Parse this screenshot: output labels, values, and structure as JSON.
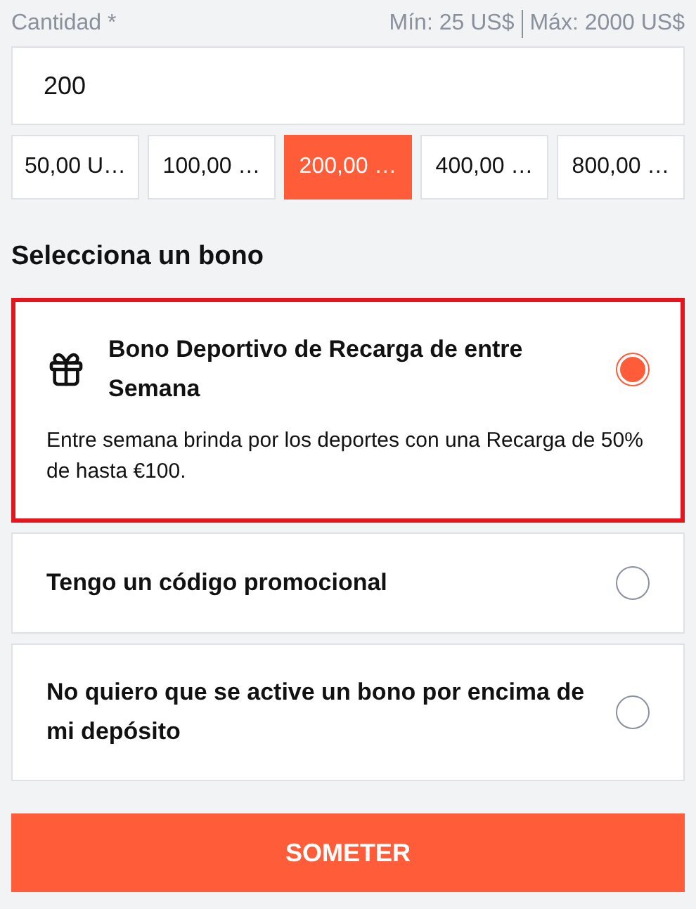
{
  "amount": {
    "label": "Cantidad *",
    "min": "Mín: 25 US$",
    "max": "Máx: 2000 US$",
    "value": "200"
  },
  "presets": [
    {
      "label": "50,00 U…",
      "selected": false
    },
    {
      "label": "100,00 …",
      "selected": false
    },
    {
      "label": "200,00 …",
      "selected": true
    },
    {
      "label": "400,00 …",
      "selected": false
    },
    {
      "label": "800,00 …",
      "selected": false
    }
  ],
  "bonus_heading": "Selecciona un bono",
  "bonuses": [
    {
      "kind": "gift",
      "title": "Bono Deportivo de Recarga de entre Semana",
      "description": "Entre semana brinda por los deportes con una Recarga de 50% de hasta €100.",
      "selected": true
    },
    {
      "kind": "plain",
      "title": "Tengo un código promocional",
      "selected": false
    },
    {
      "kind": "plain",
      "title": "No quiero que se active un bono por encima de mi depósito",
      "selected": false
    }
  ],
  "submit": "SOMETER"
}
